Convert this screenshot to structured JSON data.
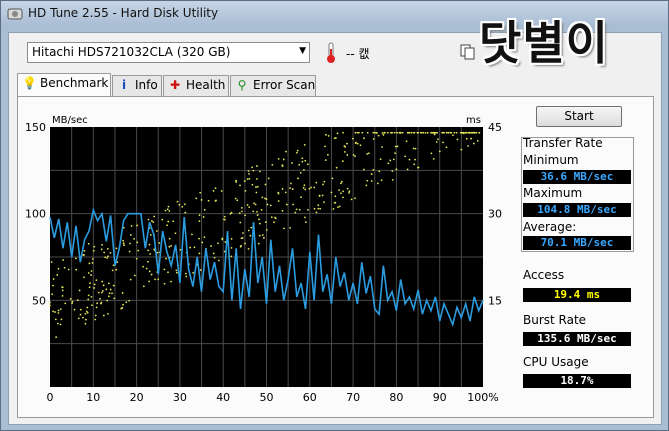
{
  "window": {
    "title": "HD Tune 2.55 - Hard Disk Utility"
  },
  "toolbar": {
    "drive": "Hitachi HDS721032CLA (320 GB)",
    "temperature": "-- 캢",
    "overlay_text": "닷별이"
  },
  "tabs": [
    {
      "label": "Benchmark",
      "icon": "lightbulb-icon"
    },
    {
      "label": "Info",
      "icon": "info-icon"
    },
    {
      "label": "Health",
      "icon": "health-cross-icon"
    },
    {
      "label": "Error Scan",
      "icon": "magnifier-icon"
    }
  ],
  "controls": {
    "start_label": "Start"
  },
  "stats": {
    "transfer_rate_label": "Transfer Rate",
    "minimum_label": "Minimum",
    "minimum_value": "36.6 MB/sec",
    "maximum_label": "Maximum",
    "maximum_value": "104.8 MB/sec",
    "average_label": "Average:",
    "average_value": "70.1 MB/sec",
    "access_label": "Access",
    "access_value": "19.4 ms",
    "burst_label": "Burst Rate",
    "burst_value": "135.6 MB/sec",
    "cpu_label": "CPU Usage",
    "cpu_value": "18.7%"
  },
  "colors": {
    "plot_bg": "#000000",
    "grid": "#4a4a4a",
    "transfer_line": "#2b9ce0",
    "access_dots": "#e6e65a",
    "value_cyan": "#3aa8ff",
    "value_yellow": "#ffff00",
    "value_white": "#ffffff"
  },
  "chart_data": {
    "type": "line",
    "ylabel": "MB/sec",
    "y2label": "ms",
    "x_ticks": [
      "0",
      "10",
      "20",
      "30",
      "40",
      "50",
      "60",
      "70",
      "80",
      "90",
      "100%"
    ],
    "y_ticks": [
      "150",
      "100",
      "50"
    ],
    "y2_ticks": [
      "45",
      "30",
      "15"
    ],
    "xlim": [
      0,
      100
    ],
    "ylim": [
      0,
      150
    ],
    "y2lim": [
      0,
      45
    ],
    "grid": true,
    "series": [
      {
        "values_x": [
          0,
          1,
          2,
          3,
          4,
          5,
          6,
          7,
          8,
          9,
          10,
          11,
          12,
          13,
          14,
          15,
          16,
          17,
          18,
          19,
          20,
          21,
          22,
          23,
          24,
          25,
          26,
          27,
          28,
          29,
          30,
          31,
          32,
          33,
          34,
          35,
          36,
          37,
          38,
          39,
          40,
          41,
          42,
          43,
          44,
          45,
          46,
          47,
          48,
          49,
          50,
          51,
          52,
          53,
          54,
          55,
          56,
          57,
          58,
          59,
          60,
          61,
          62,
          63,
          64,
          65,
          66,
          67,
          68,
          69,
          70,
          71,
          72,
          73,
          74,
          75,
          76,
          77,
          78,
          79,
          80,
          81,
          82,
          83,
          84,
          85,
          86,
          87,
          88,
          89,
          90,
          91,
          92,
          93,
          94,
          95,
          96,
          97,
          98,
          99,
          100
        ],
        "values_y": [
          98,
          86,
          97,
          80,
          95,
          75,
          93,
          72,
          85,
          90,
          102,
          96,
          100,
          84,
          99,
          70,
          80,
          96,
          100,
          100,
          100,
          100,
          80,
          95,
          88,
          65,
          90,
          78,
          70,
          82,
          60,
          98,
          68,
          58,
          75,
          55,
          80,
          62,
          72,
          58,
          55,
          90,
          50,
          80,
          45,
          68,
          52,
          95,
          60,
          75,
          48,
          85,
          55,
          70,
          50,
          62,
          80,
          52,
          60,
          45,
          78,
          50,
          88,
          55,
          65,
          48,
          75,
          58,
          66,
          50,
          60,
          48,
          72,
          54,
          64,
          45,
          42,
          70,
          50,
          55,
          44,
          62,
          48,
          52,
          45,
          56,
          42,
          50,
          44,
          52,
          38,
          48,
          42,
          36,
          46,
          40,
          48,
          38,
          52,
          44,
          50
        ]
      }
    ]
  }
}
